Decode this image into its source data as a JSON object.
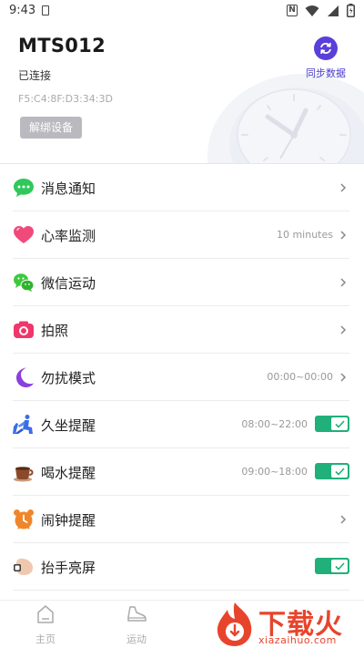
{
  "status_bar": {
    "time": "9:43",
    "nfc": "N"
  },
  "header": {
    "device_name": "MTS012",
    "connection_status": "已连接",
    "mac_address": "F5:C4:8F:D3:34:3D",
    "unbind_label": "解绑设备",
    "sync_label": "同步数据"
  },
  "settings": [
    {
      "label": "消息通知",
      "value": "",
      "control": "chevron",
      "icon": "message-bubble-icon",
      "color": "#2fc85a"
    },
    {
      "label": "心率监测",
      "value": "10 minutes",
      "control": "chevron",
      "icon": "heart-icon",
      "color": "#f04a7a"
    },
    {
      "label": "微信运动",
      "value": "",
      "control": "chevron",
      "icon": "wechat-icon",
      "color": "#3cc93c"
    },
    {
      "label": "拍照",
      "value": "",
      "control": "chevron",
      "icon": "camera-icon",
      "color": "#f0366c"
    },
    {
      "label": "勿扰模式",
      "value": "00:00~00:00",
      "control": "chevron",
      "icon": "moon-icon",
      "color": "#8a3fe0"
    },
    {
      "label": "久坐提醒",
      "value": "08:00~22:00",
      "control": "toggle_on",
      "icon": "sitting-person-icon",
      "color": "#3a6ee8"
    },
    {
      "label": "喝水提醒",
      "value": "09:00~18:00",
      "control": "toggle_on",
      "icon": "coffee-cup-icon",
      "color": "#8a4a2a"
    },
    {
      "label": "闹钟提醒",
      "value": "",
      "control": "chevron",
      "icon": "alarm-clock-icon",
      "color": "#f0862a"
    },
    {
      "label": "抬手亮屏",
      "value": "",
      "control": "toggle_on",
      "icon": "raise-hand-icon",
      "color": "#e0a890"
    }
  ],
  "bottom_nav": [
    {
      "label": "主页",
      "icon": "home-icon"
    },
    {
      "label": "运动",
      "icon": "sneaker-icon"
    }
  ],
  "watermark": {
    "text": "下载火",
    "sub": "xiazaihuo.com"
  },
  "colors": {
    "accent": "#5b3fd8",
    "toggle_on": "#21b07a",
    "watermark": "#e8442c"
  }
}
